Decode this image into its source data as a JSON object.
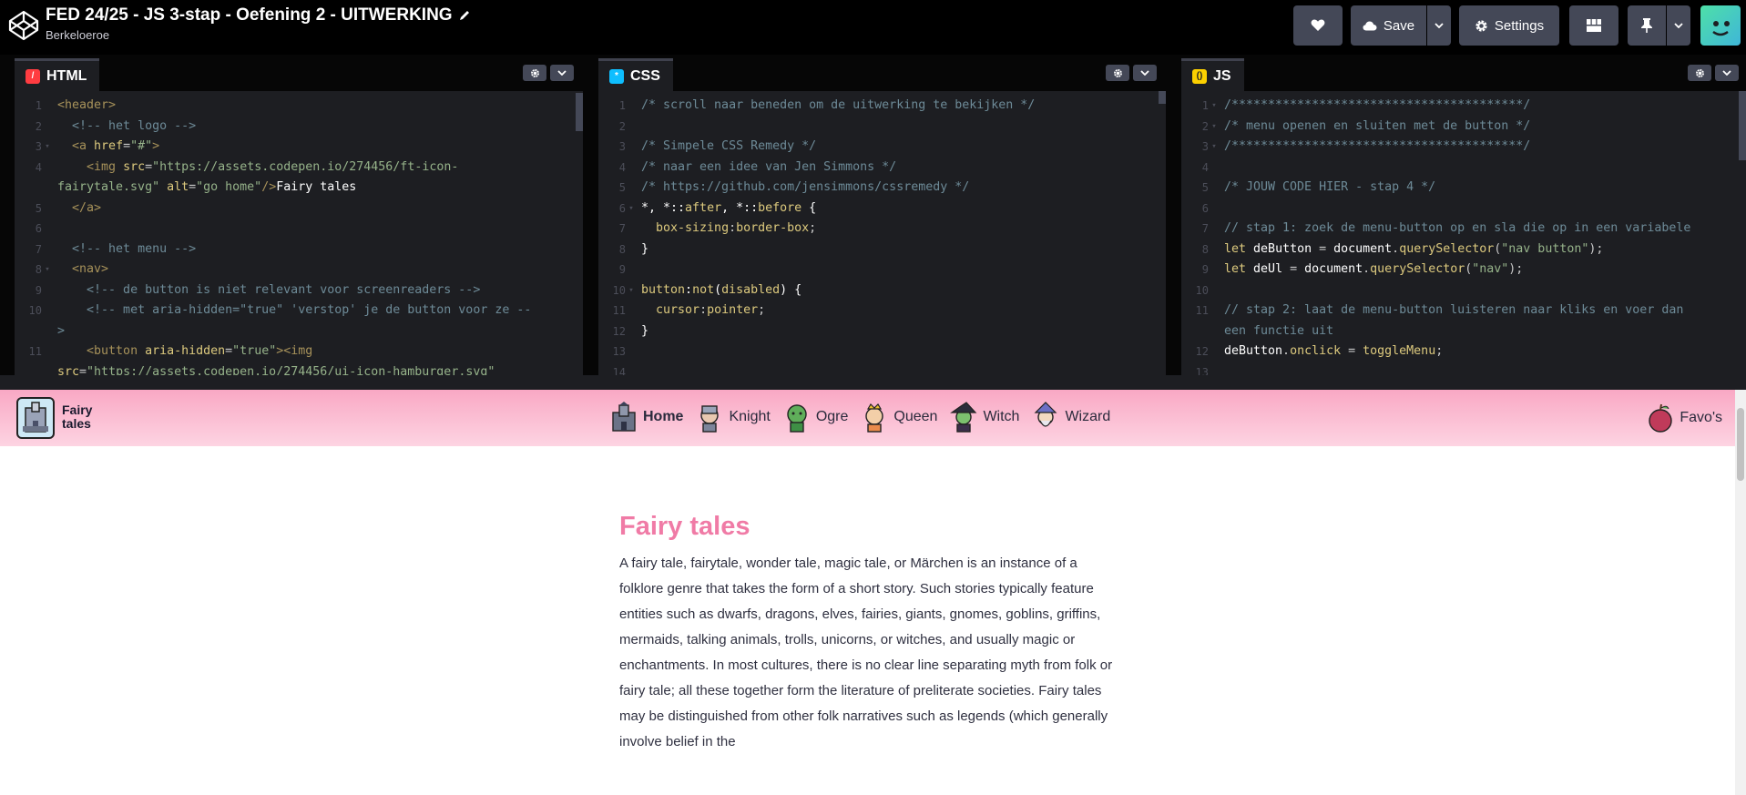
{
  "app": {
    "pen_title": "FED 24/25 - JS 3-stap - Oefening 2 - UITWERKING",
    "author": "Berkeloeroe"
  },
  "toolbar": {
    "save_label": "Save",
    "settings_label": "Settings"
  },
  "editors": {
    "html": {
      "label": "HTML",
      "lines": [
        {
          "n": "1",
          "fold": "",
          "html": "<span class='c-tag'>&lt;header&gt;</span>"
        },
        {
          "n": "2",
          "fold": "",
          "html": "  <span class='c-com'>&lt;!-- het logo --&gt;</span>"
        },
        {
          "n": "3",
          "fold": "▾",
          "html": "  <span class='c-tag'>&lt;a</span> <span class='c-att'>href</span>=<span class='c-str'>\"#\"</span><span class='c-tag'>&gt;</span>"
        },
        {
          "n": "4",
          "fold": "",
          "html": "    <span class='c-tag'>&lt;img</span> <span class='c-att'>src</span>=<span class='c-str'>\"https://assets.codepen.io/274456/ft-icon-</span>"
        },
        {
          "n": "",
          "fold": "",
          "html": "<span class='c-str'>fairytale.svg\"</span> <span class='c-att'>alt</span>=<span class='c-str'>\"go home\"</span><span class='c-tag'>/&gt;</span><span class='c-var'>Fairy tales</span>"
        },
        {
          "n": "5",
          "fold": "",
          "html": "  <span class='c-tag'>&lt;/a&gt;</span>"
        },
        {
          "n": "6",
          "fold": "",
          "html": ""
        },
        {
          "n": "7",
          "fold": "",
          "html": "  <span class='c-com'>&lt;!-- het menu --&gt;</span>"
        },
        {
          "n": "8",
          "fold": "▾",
          "html": "  <span class='c-tag'>&lt;nav&gt;</span>"
        },
        {
          "n": "9",
          "fold": "",
          "html": "    <span class='c-com'>&lt;!-- de button is niet relevant voor screenreaders --&gt;</span>"
        },
        {
          "n": "10",
          "fold": "",
          "html": "    <span class='c-com'>&lt;!-- met aria-hidden=\"true\" 'verstop' je de button voor ze --</span>"
        },
        {
          "n": "",
          "fold": "",
          "html": "<span class='c-com'>&gt;</span>"
        },
        {
          "n": "11",
          "fold": "",
          "html": "    <span class='c-tag'>&lt;button</span> <span class='c-att'>aria-hidden</span>=<span class='c-str'>\"true\"</span><span class='c-tag'>&gt;&lt;img</span>"
        },
        {
          "n": "",
          "fold": "",
          "html": "<span class='c-att'>src</span>=<span class='c-str'>\"https://assets.codepen.io/274456/ui-icon-hamburger.svg\"</span>"
        }
      ]
    },
    "css": {
      "label": "CSS",
      "lines": [
        {
          "n": "1",
          "fold": "",
          "html": "<span class='c-com'>/* scroll naar beneden om de uitwerking te bekijken */</span>"
        },
        {
          "n": "2",
          "fold": "",
          "html": ""
        },
        {
          "n": "3",
          "fold": "",
          "html": "<span class='c-com'>/* Simpele CSS Remedy */</span>"
        },
        {
          "n": "4",
          "fold": "",
          "html": "<span class='c-com'>/* naar een idee van Jen Simmons */</span>"
        },
        {
          "n": "5",
          "fold": "",
          "html": "<span class='c-com'>/* https://github.com/jensimmons/cssremedy */</span>"
        },
        {
          "n": "6",
          "fold": "▾",
          "html": "<span class='c-var'>*, *::</span><span class='c-kw'>after</span><span class='c-var'>, *::</span><span class='c-kw'>before</span> <span class='c-var'>{</span>"
        },
        {
          "n": "7",
          "fold": "",
          "html": "  <span class='c-att'>box-sizing</span>:<span class='c-kw'>border-box</span>;"
        },
        {
          "n": "8",
          "fold": "",
          "html": "<span class='c-var'>}</span>"
        },
        {
          "n": "9",
          "fold": "",
          "html": ""
        },
        {
          "n": "10",
          "fold": "▾",
          "html": "<span class='c-kw'>button</span><span class='c-var'>:</span><span class='c-kw'>not</span><span class='c-var'>(</span><span class='c-kw'>disabled</span><span class='c-var'>) {</span>"
        },
        {
          "n": "11",
          "fold": "",
          "html": "  <span class='c-att'>cursor</span>:<span class='c-kw'>pointer</span>;"
        },
        {
          "n": "12",
          "fold": "",
          "html": "<span class='c-var'>}</span>"
        },
        {
          "n": "13",
          "fold": "",
          "html": ""
        },
        {
          "n": "14",
          "fold": "",
          "html": ""
        }
      ]
    },
    "js": {
      "label": "JS",
      "lines": [
        {
          "n": "1",
          "fold": "▾",
          "html": "<span class='c-com'>/****************************************/</span>"
        },
        {
          "n": "2",
          "fold": "▾",
          "html": "<span class='c-com'>/* menu openen en sluiten met de button */</span>"
        },
        {
          "n": "3",
          "fold": "▾",
          "html": "<span class='c-com'>/****************************************/</span>"
        },
        {
          "n": "4",
          "fold": "",
          "html": ""
        },
        {
          "n": "5",
          "fold": "",
          "html": "<span class='c-com'>/* JOUW CODE HIER - stap 4 */</span>"
        },
        {
          "n": "6",
          "fold": "",
          "html": ""
        },
        {
          "n": "7",
          "fold": "",
          "html": "<span class='c-com'>// stap 1: zoek de menu-button op en sla die op in een variabele</span>"
        },
        {
          "n": "8",
          "fold": "",
          "html": "<span class='c-kw'>let</span> <span class='c-var'>deButton</span> = <span class='c-var'>document</span>.<span class='c-kw'>querySelector</span>(<span class='c-str'>\"nav button\"</span>);"
        },
        {
          "n": "9",
          "fold": "",
          "html": "<span class='c-kw'>let</span> <span class='c-var'>deUl</span> = <span class='c-var'>document</span>.<span class='c-kw'>querySelector</span>(<span class='c-str'>\"nav\"</span>);"
        },
        {
          "n": "10",
          "fold": "",
          "html": ""
        },
        {
          "n": "11",
          "fold": "",
          "html": "<span class='c-com'>// stap 2: laat de menu-button luisteren naar kliks en voer dan</span>"
        },
        {
          "n": "",
          "fold": "",
          "html": "<span class='c-com'>een functie uit</span>"
        },
        {
          "n": "12",
          "fold": "",
          "html": "<span class='c-var'>deButton</span>.<span class='c-kw'>onclick</span> = <span class='c-kw'>toggleMenu</span>;"
        },
        {
          "n": "13",
          "fold": "",
          "html": ""
        }
      ]
    }
  },
  "preview": {
    "logo_text_line1": "Fairy",
    "logo_text_line2": "tales",
    "nav": [
      {
        "label": "Home",
        "icon": "castle-icon"
      },
      {
        "label": "Knight",
        "icon": "knight-icon"
      },
      {
        "label": "Ogre",
        "icon": "ogre-icon"
      },
      {
        "label": "Queen",
        "icon": "queen-icon"
      },
      {
        "label": "Witch",
        "icon": "witch-icon"
      },
      {
        "label": "Wizard",
        "icon": "wizard-icon"
      }
    ],
    "favos_label": "Favo's",
    "heading": "Fairy tales",
    "paragraph": "A fairy tale, fairytale, wonder tale, magic tale, or Märchen is an instance of a folklore genre that takes the form of a short story. Such stories typically feature entities such as dwarfs, dragons, elves, fairies, giants, gnomes, goblins, griffins, mermaids, talking animals, trolls, unicorns, or witches, and usually magic or enchantments. In most cultures, there is no clear line separating myth from folk or fairy tale; all these together form the literature of preliterate societies. Fairy tales may be distinguished from other folk narratives such as legends (which generally involve belief in the"
  },
  "colors": {
    "heading_pink": "#f07ba6",
    "header_pink": "#f9a8c4",
    "html_badge": "#ff3c41",
    "css_badge": "#0ebeff",
    "js_badge": "#fcd000"
  }
}
